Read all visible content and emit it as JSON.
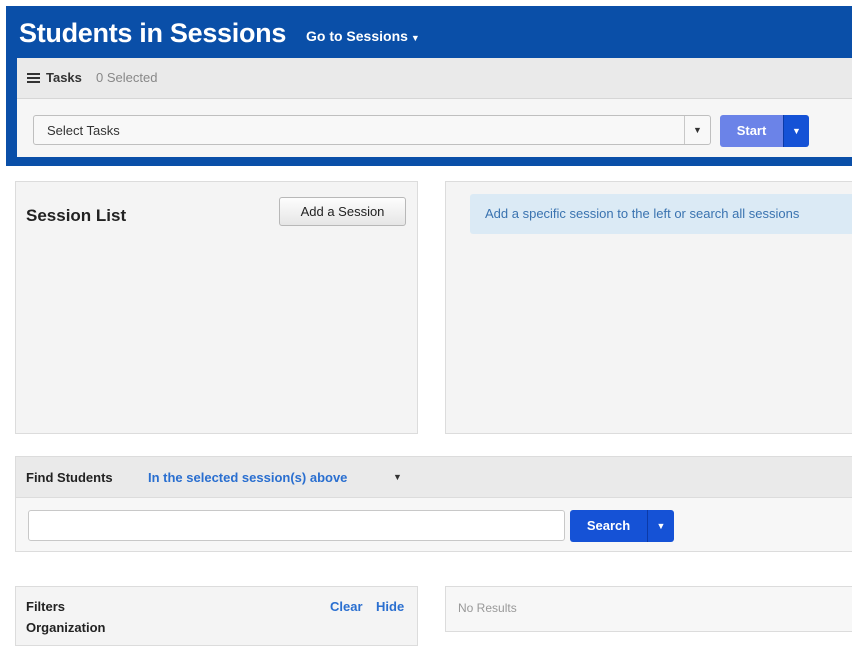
{
  "header": {
    "title": "Students in Sessions",
    "goto_label": "Go to Sessions",
    "background": "#0a4fa8"
  },
  "tasks": {
    "label": "Tasks",
    "count": "0 Selected",
    "select_value": "Select Tasks",
    "start_label": "Start"
  },
  "session_list": {
    "title": "Session List",
    "add_label": "Add a Session"
  },
  "info": {
    "message": "Add a specific session to the left or search all sessions"
  },
  "find": {
    "label": "Find Students",
    "scope": "In the selected session(s) above",
    "search_value": "",
    "search_label": "Search"
  },
  "filters": {
    "title": "Filters",
    "organization": "Organization",
    "clear_label": "Clear",
    "hide_label": "Hide"
  },
  "results": {
    "message": "No Results"
  },
  "icons": {
    "tasks": "list-icon",
    "dropdown": "caret-down-icon"
  },
  "colors": {
    "primary_button": "#1552d6",
    "start_button": "#6b83e8",
    "link": "#2a6fd0",
    "info_bg": "#dbeaf5"
  }
}
